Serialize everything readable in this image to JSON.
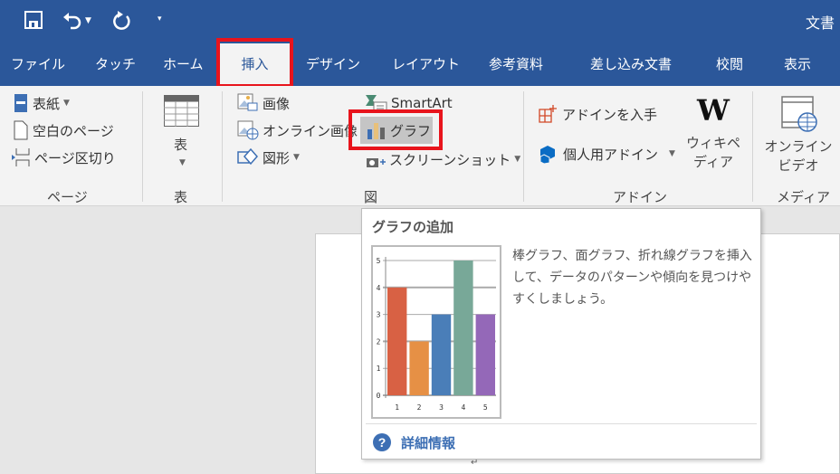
{
  "title": "文書",
  "tabs": [
    "ファイル",
    "タッチ",
    "ホーム",
    "挿入",
    "デザイン",
    "レイアウト",
    "参考資料",
    "差し込み文書",
    "校閲",
    "表示"
  ],
  "ribbon": {
    "page_group": {
      "label": "ページ",
      "cover": "表紙",
      "blank": "空白のページ",
      "break": "ページ区切り"
    },
    "table_group": {
      "label": "表",
      "button": "表"
    },
    "illus_group": {
      "label": "図",
      "picture": "画像",
      "online_picture": "オンライン画像",
      "shapes": "図形",
      "smartart": "SmartArt",
      "chart": "グラフ",
      "screenshot": "スクリーンショット"
    },
    "addin_group": {
      "label": "アドイン",
      "get": "アドインを入手",
      "my": "個人用アドイン",
      "wiki1": "ウィキペ",
      "wiki2": "ディア"
    },
    "media_group": {
      "label": "メディア",
      "video1": "オンライン",
      "video2": "ビデオ"
    }
  },
  "tooltip": {
    "title": "グラフの追加",
    "desc": "棒グラフ、面グラフ、折れ線グラフを挿入して、データのパターンや傾向を見つけやすくしましょう。",
    "more": "詳細情報"
  },
  "chart_data": {
    "type": "bar",
    "categories": [
      "1",
      "2",
      "3",
      "4",
      "5"
    ],
    "values": [
      4,
      2,
      3,
      5,
      3
    ],
    "colors": [
      "#d86144",
      "#e69045",
      "#4a7eb8",
      "#78a898",
      "#9468b8"
    ],
    "ylim": [
      0,
      5
    ],
    "yticks": [
      "0",
      "1",
      "2",
      "3",
      "4",
      "5"
    ],
    "title": "",
    "xlabel": "",
    "ylabel": ""
  }
}
